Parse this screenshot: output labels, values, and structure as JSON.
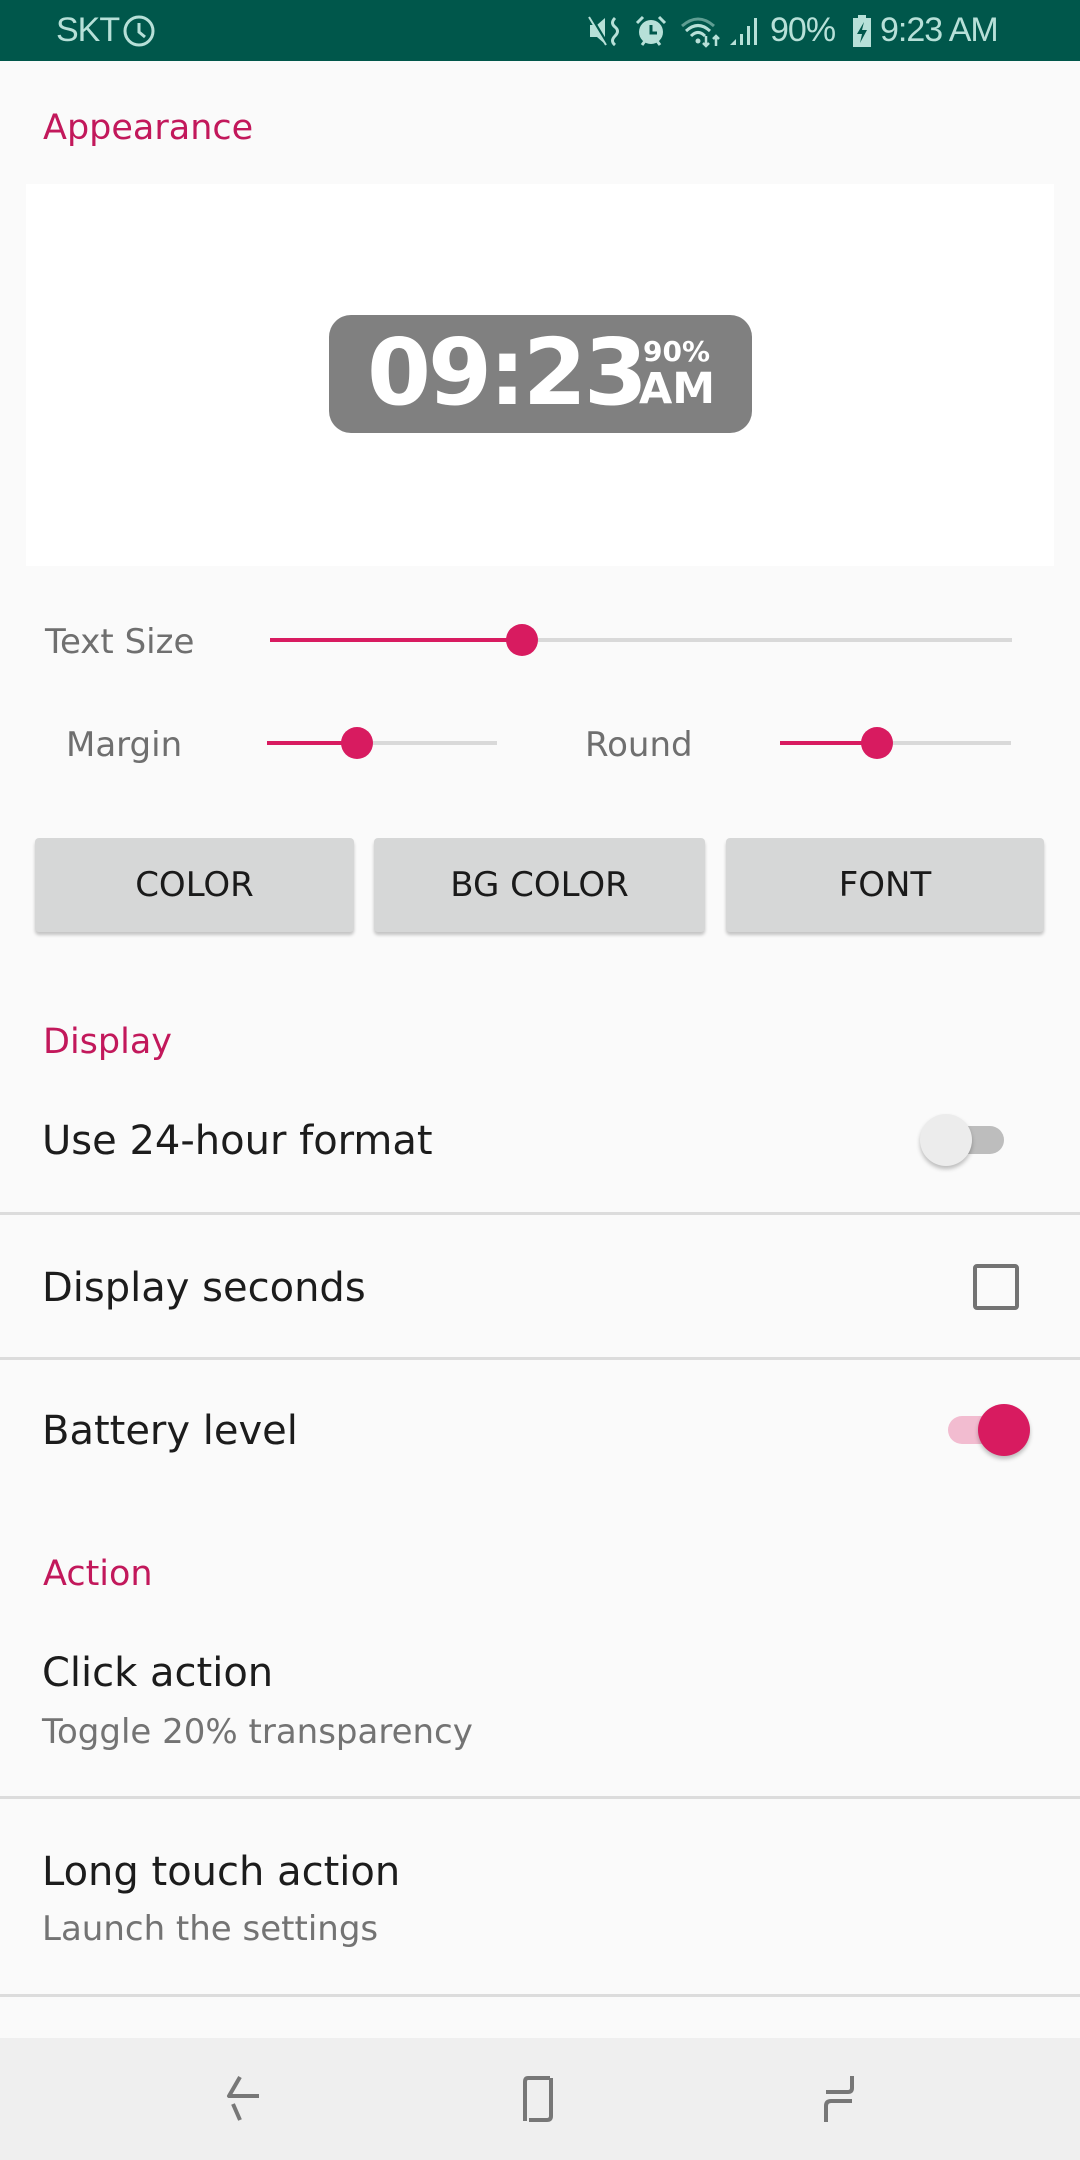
{
  "status_bar": {
    "carrier": "SKT",
    "battery_percent": "90%",
    "time": "9:23 AM",
    "icons": [
      "clock-icon",
      "mute-icon",
      "alarm-icon",
      "wifi-icon",
      "signal-icon",
      "battery-charging-icon"
    ]
  },
  "appearance": {
    "header": "Appearance",
    "preview": {
      "time": "09:23",
      "battery": "90%",
      "ampm": "AM"
    },
    "sliders": {
      "text_size": {
        "label": "Text Size",
        "value": 0.34
      },
      "margin": {
        "label": "Margin",
        "value": 0.39
      },
      "round": {
        "label": "Round",
        "value": 0.42
      }
    },
    "buttons": {
      "color": "COLOR",
      "bg_color": "BG COLOR",
      "font": "FONT"
    }
  },
  "display": {
    "header": "Display",
    "use_24_hour": {
      "label": "Use 24-hour format",
      "checked": false
    },
    "display_seconds": {
      "label": "Display seconds",
      "checked": false
    },
    "battery_level": {
      "label": "Battery level",
      "checked": true
    }
  },
  "action": {
    "header": "Action",
    "click_action": {
      "title": "Click action",
      "summary": "Toggle 20% transparency"
    },
    "long_touch_action": {
      "title": "Long touch action",
      "summary": "Launch the settings"
    }
  },
  "nav_bar": {
    "buttons": [
      "back",
      "home",
      "recents"
    ]
  },
  "colors": {
    "accent": "#d81b60",
    "header": "#c2185b",
    "status_bar": "#00574b",
    "preview_bg": "#808080"
  }
}
